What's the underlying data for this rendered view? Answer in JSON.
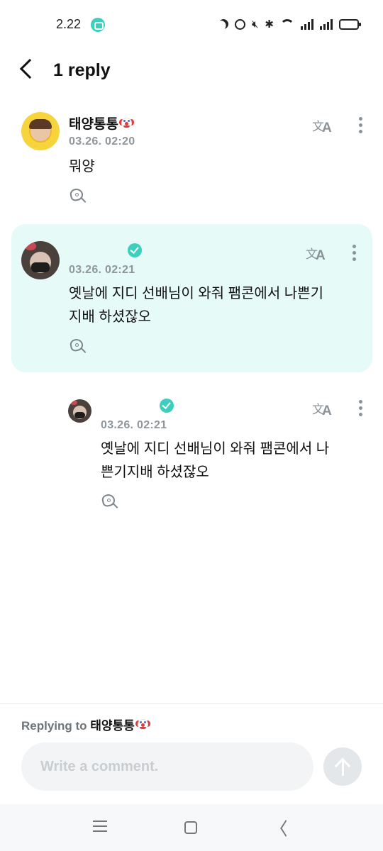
{
  "status_bar": {
    "time": "2.22",
    "icons": [
      "app-notification-icon",
      "moon-icon",
      "alarm-icon",
      "mute-icon",
      "bluetooth-icon",
      "wifi-icon",
      "signal-icon",
      "signal-icon",
      "battery-icon"
    ],
    "battery_level": 0.8
  },
  "header": {
    "title": "1 reply",
    "back_icon": "chevron-left-icon"
  },
  "comments": [
    {
      "author": "태양통통",
      "author_emoji": "clown-face-icon",
      "timestamp": "03.26. 02:20",
      "text": "뭐양",
      "verified": false,
      "highlighted": false
    },
    {
      "author": "",
      "verified": true,
      "timestamp": "03.26. 02:21",
      "text": "옛날에 지디 선배님이 와줘 팸콘에서 나쁜기\n지배 하셨잖오",
      "highlighted": true
    },
    {
      "author": "",
      "verified": true,
      "timestamp": "03.26. 02:21",
      "text": "옛날에 지디 선배님이 와줘 팸콘에서 나\n쁜기지배 하셨잖오",
      "highlighted": false
    }
  ],
  "footer": {
    "replying_to_label": "Replying to",
    "replying_to_name": "태양통통",
    "replying_to_emoji": "clown-face-icon",
    "comment_placeholder": "Write a comment.",
    "comment_value": ""
  },
  "nav_bar": {
    "icons": [
      "menu-icon",
      "home-icon",
      "back-icon"
    ]
  },
  "colors": {
    "accent": "#3ccfbd",
    "highlight_background": "#e6faf7",
    "muted_text": "#8f969c"
  }
}
